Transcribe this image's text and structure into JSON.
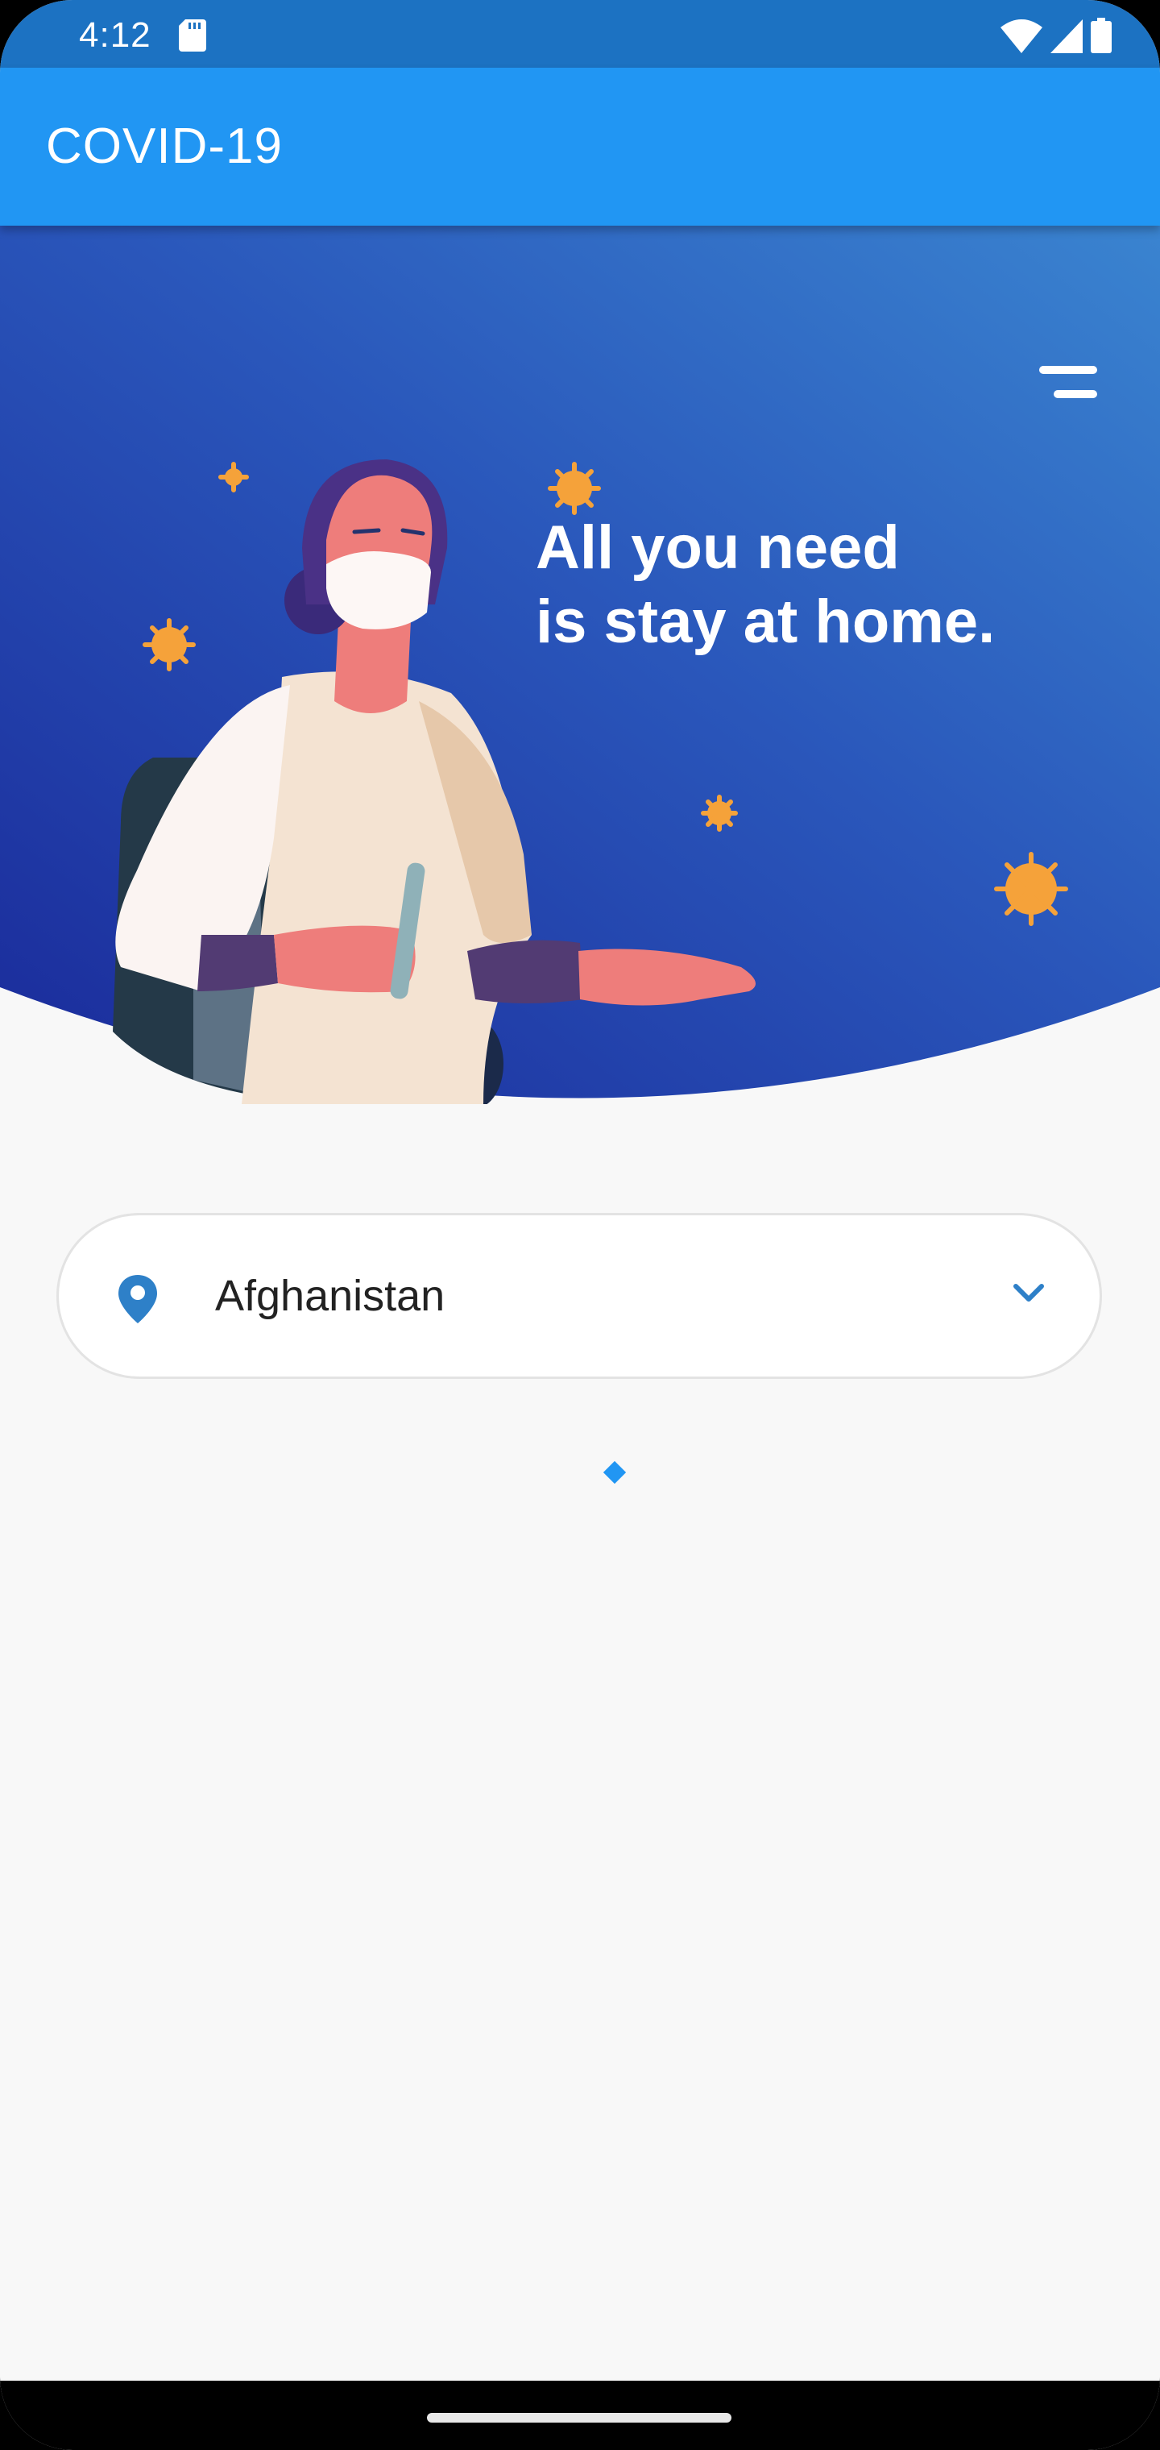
{
  "status_bar": {
    "time": "4:12",
    "icons": [
      "sd-card-icon",
      "wifi-icon",
      "signal-icon",
      "battery-icon"
    ]
  },
  "app_bar": {
    "title": "COVID-19",
    "color": "#2196f3"
  },
  "hero": {
    "headline_line1": "All you need",
    "headline_line2": "is stay at home.",
    "menu_icon": "menu-icon",
    "gradient": [
      "#2a50b8",
      "#1c2f9c",
      "#3a7fcf"
    ]
  },
  "country_select": {
    "icon": "location-pin-icon",
    "selected": "Afghanistan",
    "chevron_icon": "chevron-down-icon",
    "accent": "#2e80c8"
  },
  "loading": {
    "icon": "loading-indicator"
  }
}
